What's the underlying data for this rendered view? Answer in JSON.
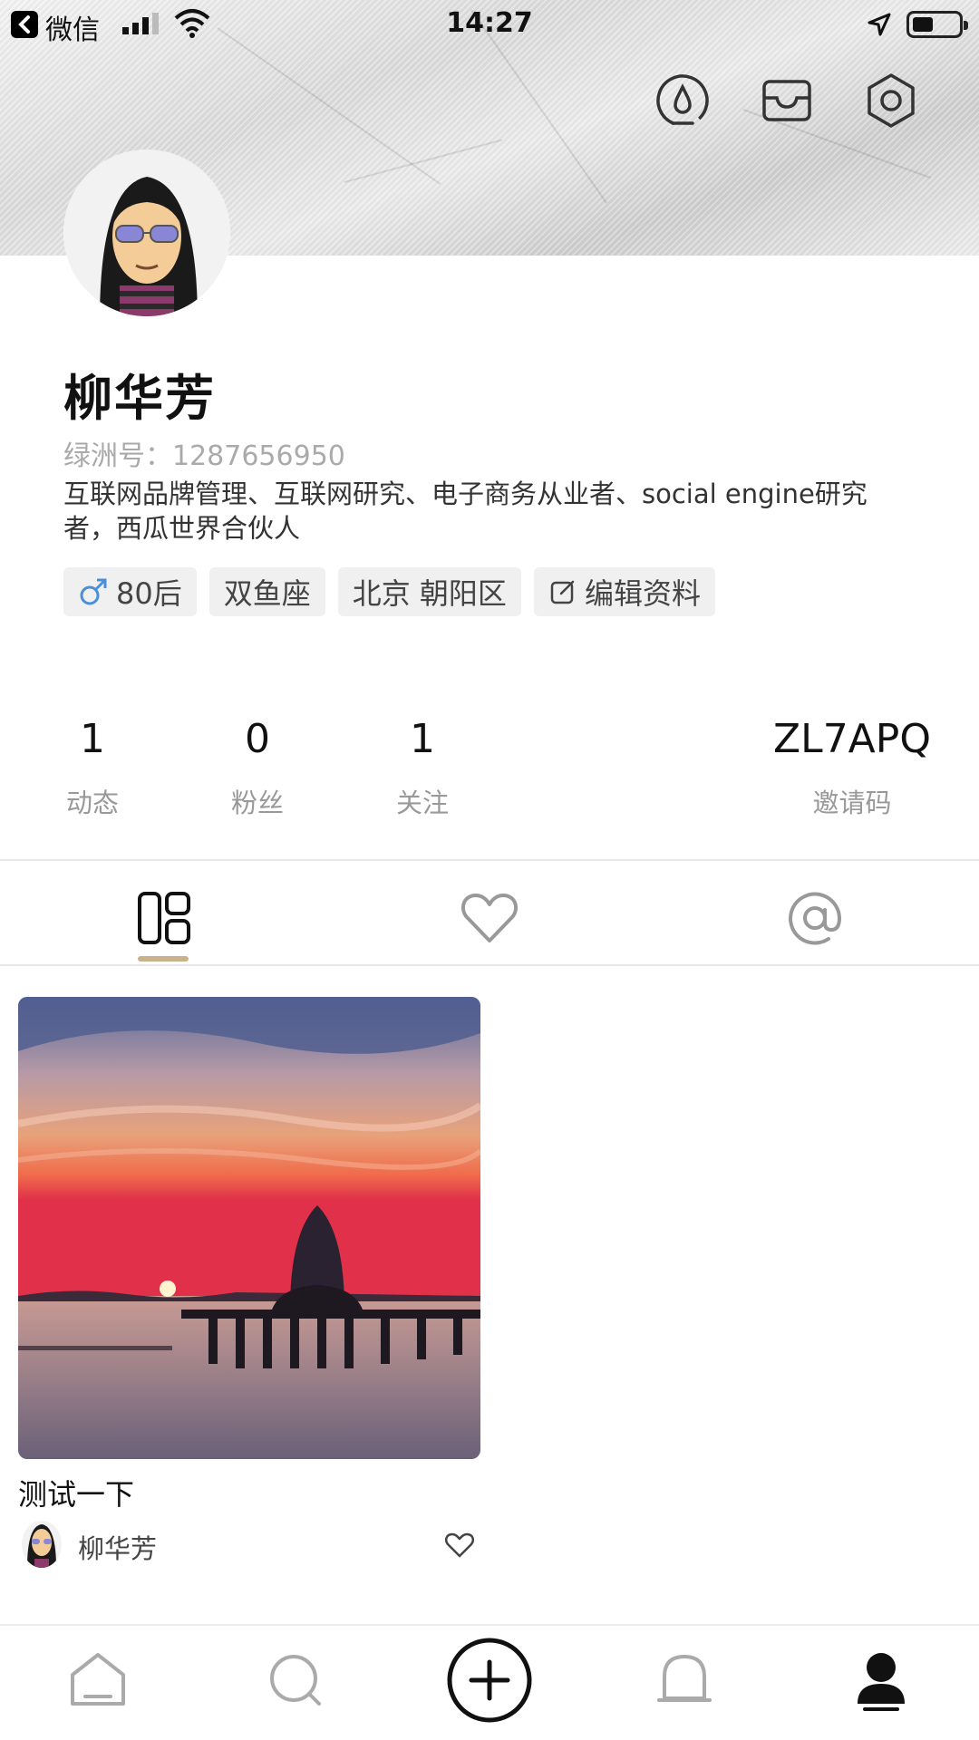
{
  "status_bar": {
    "back_app": "微信",
    "time": "14:27"
  },
  "profile": {
    "name": "柳华芳",
    "id_label": "绿洲号：",
    "id_value": "1287656950",
    "bio": "互联网品牌管理、互联网研究、电子商务从业者、social engine研究者，西瓜世界合伙人",
    "tags": {
      "age": "80后",
      "zodiac": "双鱼座",
      "location": "北京 朝阳区",
      "edit": "编辑资料"
    }
  },
  "stats": {
    "posts": {
      "value": "1",
      "label": "动态"
    },
    "fans": {
      "value": "0",
      "label": "粉丝"
    },
    "following": {
      "value": "1",
      "label": "关注"
    },
    "invite": {
      "value": "ZL7APQ",
      "label": "邀请码"
    }
  },
  "tabs": {
    "active": "grid"
  },
  "posts": [
    {
      "title": "测试一下",
      "author": "柳华芳"
    }
  ],
  "colors": {
    "accent": "#c8b28a",
    "male": "#4a90d9",
    "text_muted": "#999999"
  },
  "icons": {
    "header": [
      "drop-icon",
      "inbox-icon",
      "settings-hex-icon"
    ],
    "tabs": [
      "grid-icon",
      "heart-icon",
      "at-icon"
    ],
    "nav": [
      "home-icon",
      "search-icon",
      "add-circle-icon",
      "bell-icon",
      "profile-icon"
    ]
  }
}
